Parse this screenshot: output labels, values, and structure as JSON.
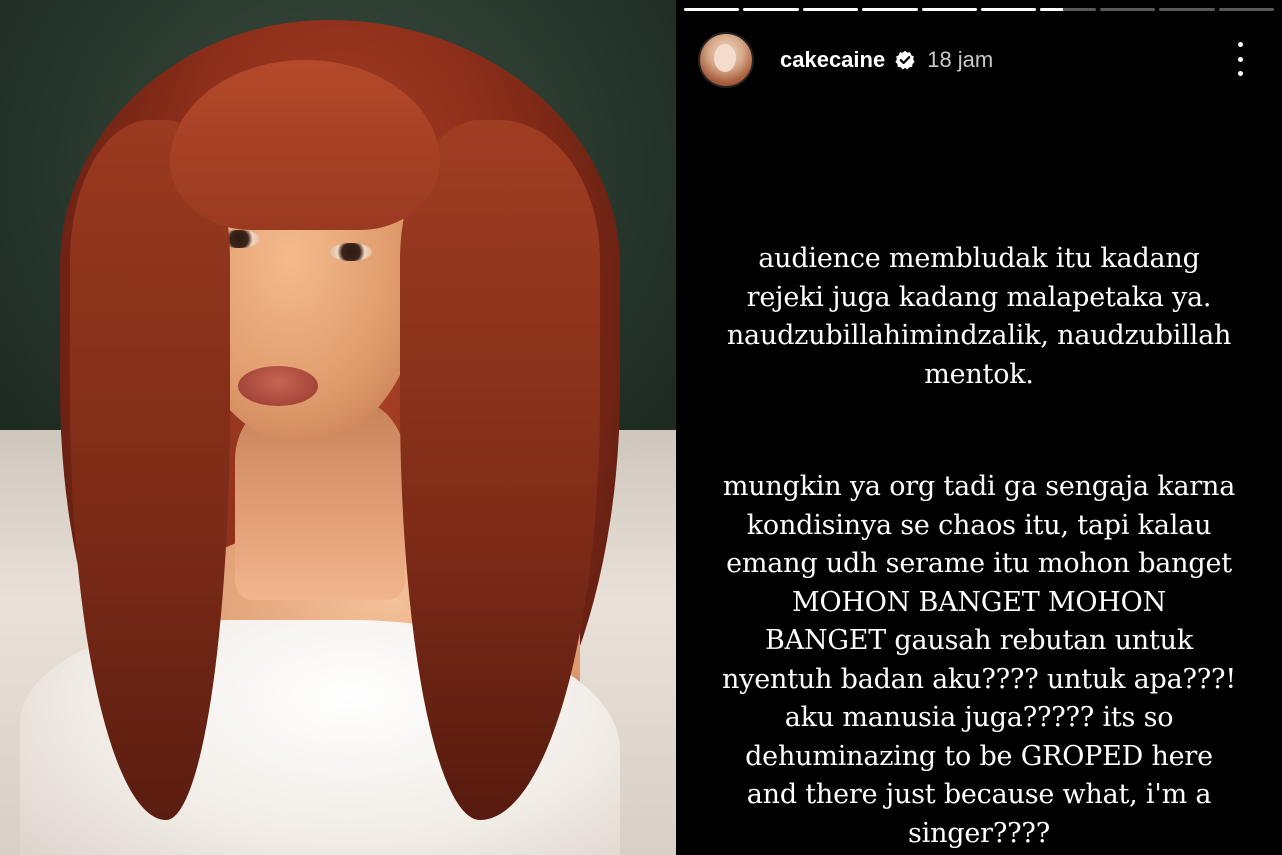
{
  "story": {
    "username": "cakecaine",
    "verified": true,
    "timestamp": "18 jam",
    "progress": {
      "segments": 10,
      "current_index": 6,
      "current_fill": 0.4
    },
    "paragraphs": [
      "audience membludak itu kadang\nrejeki juga kadang malapetaka ya.\nnaudzubillahimindzalik, naudzubillah\nmentok.",
      "mungkin ya org tadi ga sengaja karna\nkondisinya se chaos itu, tapi kalau\nemang udh serame itu mohon banget\nMOHON BANGET MOHON\nBANGET gausah rebutan untuk\nnyentuh badan aku???? untuk apa???!\naku manusia juga????? its so\ndehuminazing to be GROPED here\nand there just because what, i'm a\nsinger????"
    ]
  },
  "colors": {
    "story_background": "#000000",
    "text": "#ffffff",
    "timestamp": "#c9c9c9",
    "progress_track": "rgba(255,255,255,0.35)",
    "progress_fill": "#ffffff"
  },
  "icons": {
    "verified": "verified-badge-icon",
    "more": "more-options-icon"
  }
}
